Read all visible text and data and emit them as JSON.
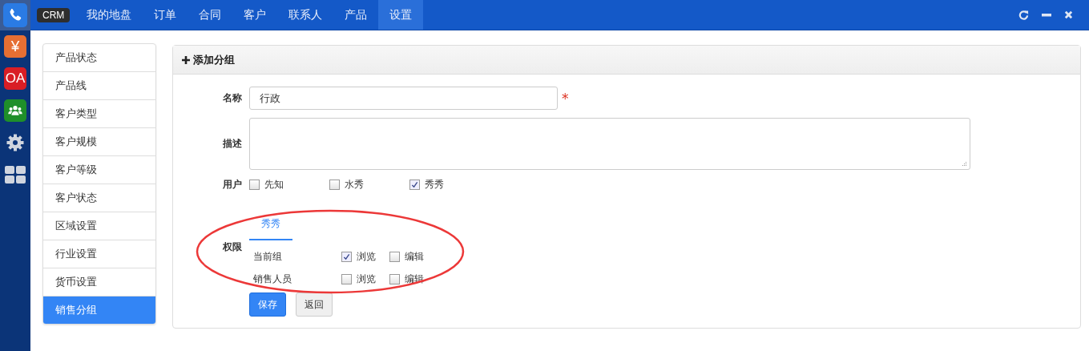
{
  "rail": [
    {
      "kind": "phone",
      "selected": true
    },
    {
      "kind": "yen",
      "label": "¥",
      "selected": false
    },
    {
      "kind": "oa",
      "label": "OA",
      "selected": false
    },
    {
      "kind": "people",
      "selected": false
    },
    {
      "kind": "gear",
      "selected": false
    },
    {
      "kind": "grid",
      "selected": false
    }
  ],
  "tooltip": "CRM",
  "nav": [
    {
      "label": "我的地盘",
      "selected": false
    },
    {
      "label": "订单",
      "selected": false
    },
    {
      "label": "合同",
      "selected": false
    },
    {
      "label": "客户",
      "selected": false
    },
    {
      "label": "联系人",
      "selected": false
    },
    {
      "label": "产品",
      "selected": false
    },
    {
      "label": "设置",
      "selected": true
    }
  ],
  "sidebar": {
    "items": [
      {
        "label": "产品状态",
        "selected": false
      },
      {
        "label": "产品线",
        "selected": false
      },
      {
        "label": "客户类型",
        "selected": false
      },
      {
        "label": "客户规模",
        "selected": false
      },
      {
        "label": "客户等级",
        "selected": false
      },
      {
        "label": "客户状态",
        "selected": false
      },
      {
        "label": "区域设置",
        "selected": false
      },
      {
        "label": "行业设置",
        "selected": false
      },
      {
        "label": "货币设置",
        "selected": false
      },
      {
        "label": "销售分组",
        "selected": true
      }
    ]
  },
  "panel": {
    "title": "添加分组",
    "name": {
      "label": "名称",
      "value": "行政",
      "required_mark": "*"
    },
    "description": {
      "label": "描述"
    },
    "users": {
      "label": "用户",
      "options": [
        {
          "label": "先知",
          "checked": false
        },
        {
          "label": "水秀",
          "checked": false
        },
        {
          "label": "秀秀",
          "checked": true
        }
      ]
    },
    "permissions": {
      "label": "权限",
      "tabs": [
        {
          "label": "秀秀",
          "selected": true
        }
      ],
      "rows": [
        {
          "role": "当前组",
          "view": {
            "label": "浏览",
            "checked": true
          },
          "edit": {
            "label": "编辑",
            "checked": false
          }
        },
        {
          "role": "销售人员",
          "view": {
            "label": "浏览",
            "checked": false
          },
          "edit": {
            "label": "编辑",
            "checked": false
          }
        }
      ],
      "highlighted": true
    },
    "buttons": [
      {
        "label": "保存",
        "kind": "primary"
      },
      {
        "label": "返回",
        "kind": "default"
      }
    ]
  }
}
